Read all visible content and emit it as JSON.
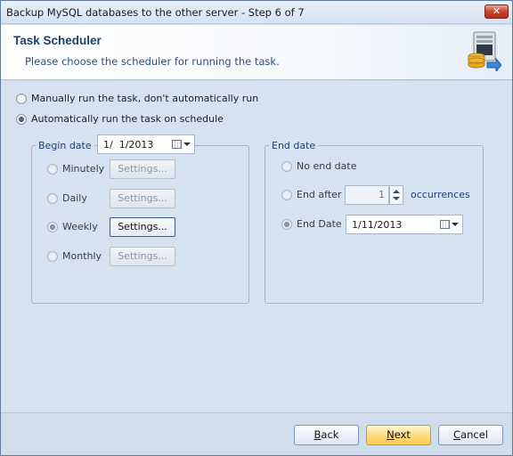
{
  "window": {
    "title": "Backup MySQL databases to the other server - Step 6 of 7",
    "close_glyph": "✕"
  },
  "header": {
    "title": "Task Scheduler",
    "subtitle": "Please choose the scheduler for running the task.",
    "icon": "database-server-icon"
  },
  "run_mode": {
    "manual_label": "Manually run the task, don't automatically run",
    "auto_label": "Automatically run the task on schedule",
    "selected": "auto"
  },
  "begin_date": {
    "legend": "Begin date",
    "value": "1/  1/2013",
    "options": [
      {
        "label": "Minutely",
        "button": "Settings...",
        "enabled": false
      },
      {
        "label": "Daily",
        "button": "Settings...",
        "enabled": false
      },
      {
        "label": "Weekly",
        "button": "Settings...",
        "enabled": true
      },
      {
        "label": "Monthly",
        "button": "Settings...",
        "enabled": false
      }
    ],
    "selected": "Weekly"
  },
  "end_date": {
    "legend": "End date",
    "no_end_label": "No end date",
    "end_after_label": "End after",
    "occurrences_value": "1",
    "occurrences_label": "occurrences",
    "end_date_label": "End Date",
    "end_date_value": "1/11/2013",
    "selected": "End Date"
  },
  "footer": {
    "back_label": "ack",
    "back_mnemonic": "B",
    "next_label": "ext",
    "next_mnemonic": "N",
    "cancel_label": "ancel",
    "cancel_mnemonic": "C"
  },
  "colors": {
    "accent": "#1c3f6e",
    "background": "#d5e2f2",
    "primary_button": "#ffd97a"
  }
}
